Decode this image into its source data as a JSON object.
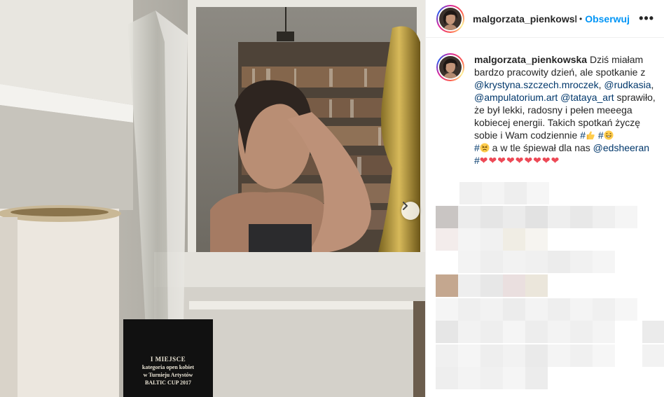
{
  "post": {
    "username": "malgorzata_pienkowska",
    "username_header": "malgorzata_pienkowsk",
    "dot": "•",
    "follow_label": "Obserwuj",
    "more_label": "•••",
    "caption": {
      "part1": " Dziś miałam bardzo pracowity dzień, ale spotkanie z ",
      "mention1": "@krystyna.szczech.mroczek",
      "sep1": ", ",
      "mention2": "@rudkasia",
      "sep2": ", ",
      "mention3": "@ampulatorium.art",
      "sep3": " ",
      "mention4": "@tataya_art",
      "part2": " sprawiło, że był lekki, radosny i pełen meeega kobiecej energii. Takich spotkań życzę sobie i Wam codziennie ",
      "hash1": "#",
      "hash2": " #",
      "hash3": "#",
      "part3": " a w tle śpiewał dla nas ",
      "mention5": "@edsheeran",
      "hash4": "#",
      "hearts": "❤❤❤❤❤❤❤❤❤"
    }
  },
  "photo": {
    "plaque": {
      "line1": "I MIEJSCE",
      "line2": "kategoria open kobiet",
      "line3": "w Turnieju Artystów",
      "line4": "BALTIC CUP 2017"
    },
    "next_icon": "chevron-right-icon"
  },
  "colors": {
    "accent": "#0095f6",
    "mention": "#00376b",
    "heart": "#ed4956"
  }
}
